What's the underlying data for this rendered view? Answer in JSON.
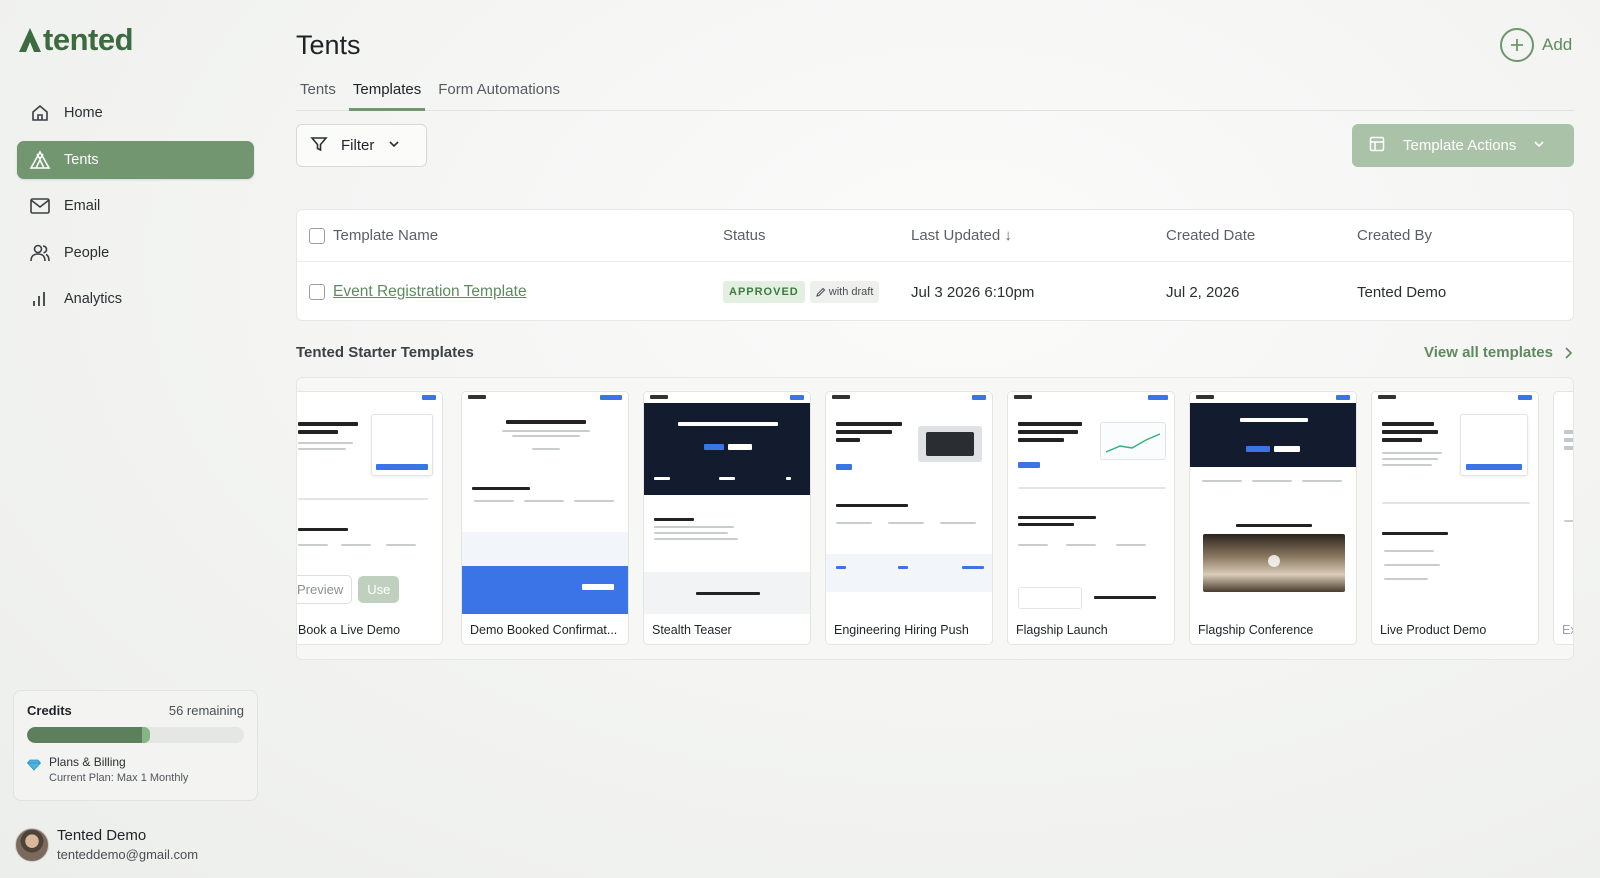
{
  "app": {
    "logo_text": "tented"
  },
  "sidebar": {
    "items": [
      {
        "label": "Home",
        "icon": "home-icon",
        "active": false
      },
      {
        "label": "Tents",
        "icon": "tent-icon",
        "active": true
      },
      {
        "label": "Email",
        "icon": "mail-icon",
        "active": false
      },
      {
        "label": "People",
        "icon": "people-icon",
        "active": false
      },
      {
        "label": "Analytics",
        "icon": "bar-chart-icon",
        "active": false
      }
    ],
    "credits": {
      "title": "Credits",
      "remaining": "56 remaining",
      "progress_fraction": 0.54,
      "billing_title": "Plans & Billing",
      "billing_plan": "Current Plan: Max 1 Monthly"
    },
    "user": {
      "name": "Tented Demo",
      "email": "tenteddemo@gmail.com"
    }
  },
  "header": {
    "title": "Tents",
    "add_label": "Add"
  },
  "tabs": [
    {
      "label": "Tents",
      "active": false
    },
    {
      "label": "Templates",
      "active": true
    },
    {
      "label": "Form Automations",
      "active": false
    }
  ],
  "toolbar": {
    "filter_label": "Filter",
    "actions_label": "Template Actions"
  },
  "table": {
    "columns": [
      "Template Name",
      "Status",
      "Last Updated ↓",
      "Created Date",
      "Created By"
    ],
    "rows": [
      {
        "name": "Event Registration Template",
        "status": "APPROVED",
        "draft": "with draft",
        "last_updated": "Jul 3 2026 6:10pm",
        "created_date": "Jul 2, 2026",
        "created_by": "Tented Demo"
      }
    ]
  },
  "starter": {
    "title": "Tented Starter Templates",
    "view_all": "View all templates",
    "preview_label": "Preview",
    "use_label": "Use",
    "cards": [
      {
        "title": "Book a Live Demo"
      },
      {
        "title": "Demo Booked Confirmat..."
      },
      {
        "title": "Stealth Teaser"
      },
      {
        "title": "Engineering Hiring Push"
      },
      {
        "title": "Flagship Launch"
      },
      {
        "title": "Flagship Conference"
      },
      {
        "title": "Live Product Demo"
      },
      {
        "title": "Ex"
      }
    ]
  },
  "colors": {
    "brand": "#5e8a5d",
    "active_nav": "#72966f",
    "button_disabled": "#aac2a8",
    "badge_bg": "#e3efe0"
  }
}
